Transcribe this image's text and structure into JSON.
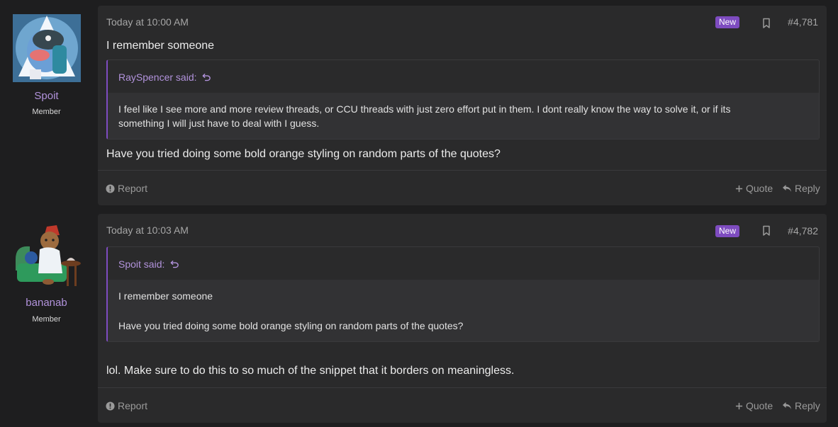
{
  "posts": [
    {
      "username": "Spoit",
      "user_title": "Member",
      "time": "Today at 10:00 AM",
      "badge": "New",
      "post_number": "#4,781",
      "intro_text": "I remember someone",
      "quote": {
        "attribution": "RaySpencer said:",
        "lines": [
          "I feel like I see more and more review threads, or CCU threads with just zero effort put in them. I dont really know the way to solve it, or if its",
          "something I will just have to deal with I guess."
        ]
      },
      "body_text": "Have you tried doing some bold orange styling on random parts of the quotes?",
      "footer": {
        "report": "Report",
        "quote": "Quote",
        "reply": "Reply"
      }
    },
    {
      "username": "bananab",
      "user_title": "Member",
      "time": "Today at 10:03 AM",
      "badge": "New",
      "post_number": "#4,782",
      "quote": {
        "attribution": "Spoit said:",
        "lines": [
          "I remember someone",
          "Have you tried doing some bold orange styling on random parts of the quotes?"
        ]
      },
      "body_text": "lol. Make sure to do this to so much of the snippet that it borders on meaningless.",
      "footer": {
        "report": "Report",
        "quote": "Quote",
        "reply": "Reply"
      }
    }
  ],
  "icons": {
    "bookmark": "bookmark-icon",
    "reply_arrow": "reply-arrow-icon",
    "report": "report-icon",
    "plus": "plus-icon",
    "jump": "jump-to-quote-icon"
  },
  "colors": {
    "accent_purple": "#b293dc",
    "badge_purple": "#7e4cc0",
    "card_bg": "#2a2a2b",
    "page_bg": "#1e1e1f"
  }
}
